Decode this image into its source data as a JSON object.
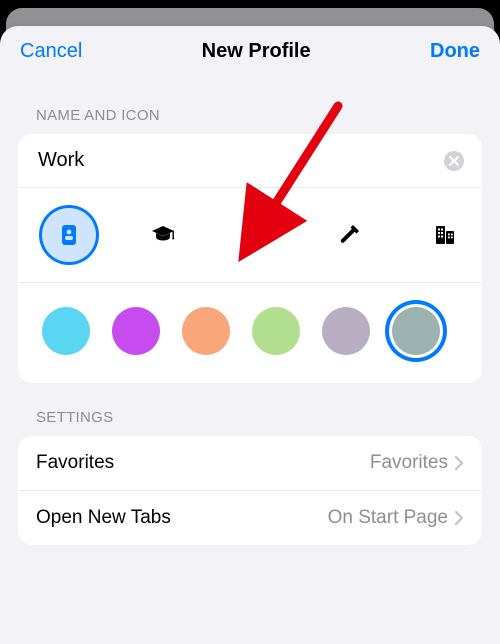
{
  "nav": {
    "cancel": "Cancel",
    "title": "New Profile",
    "done": "Done"
  },
  "sections": {
    "name_and_icon": "NAME AND ICON",
    "settings": "SETTINGS"
  },
  "profile_name": "Work",
  "icons": [
    {
      "name": "badge-icon",
      "selected": true
    },
    {
      "name": "graduation-cap-icon",
      "selected": false
    },
    {
      "name": "briefcase-icon",
      "selected": false
    },
    {
      "name": "hammer-icon",
      "selected": false
    },
    {
      "name": "building-icon",
      "selected": false
    },
    {
      "name": "globe-icon",
      "selected": false
    }
  ],
  "colors": [
    {
      "hex": "#5ad6f2",
      "selected": false
    },
    {
      "hex": "#c74cf0",
      "selected": false
    },
    {
      "hex": "#f9a77a",
      "selected": false
    },
    {
      "hex": "#b1df8f",
      "selected": false
    },
    {
      "hex": "#b7aec2",
      "selected": false
    },
    {
      "hex": "#9cb2b1",
      "selected": true
    }
  ],
  "settings_rows": {
    "favorites": {
      "label": "Favorites",
      "value": "Favorites"
    },
    "open_new_tabs": {
      "label": "Open New Tabs",
      "value": "On Start Page"
    }
  },
  "annotation": {
    "type": "red-arrow",
    "points_to": "briefcase-icon"
  }
}
